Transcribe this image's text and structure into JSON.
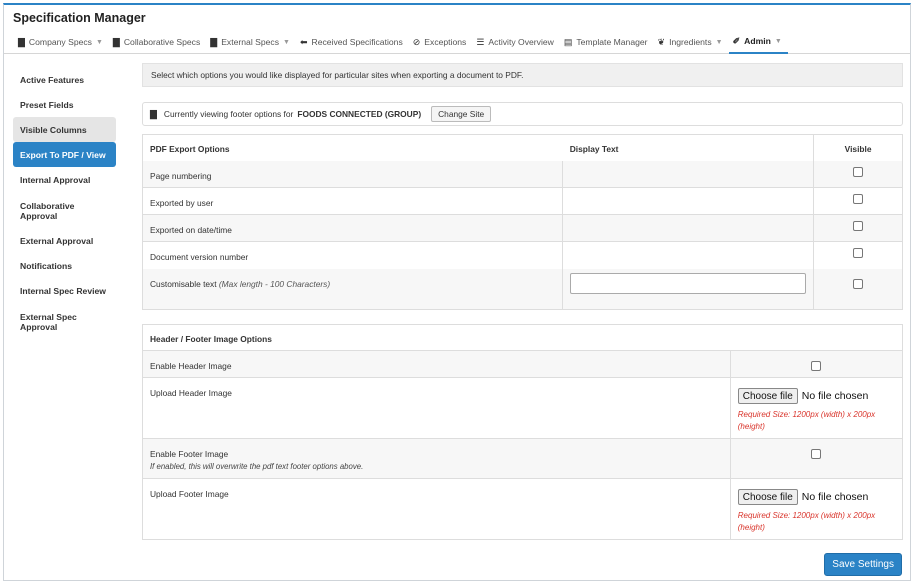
{
  "app": {
    "title": "Specification Manager"
  },
  "nav": [
    {
      "label": "Company Specs",
      "icon": "building-icon",
      "glyph": "▇",
      "caret": true
    },
    {
      "label": "Collaborative Specs",
      "icon": "building-icon",
      "glyph": "▇",
      "caret": false
    },
    {
      "label": "External Specs",
      "icon": "building-icon",
      "glyph": "▇",
      "caret": true
    },
    {
      "label": "Received Specifications",
      "icon": "arrow-left-icon",
      "glyph": "⬅",
      "caret": false
    },
    {
      "label": "Exceptions",
      "icon": "check-circle-icon",
      "glyph": "⊘",
      "caret": false
    },
    {
      "label": "Activity Overview",
      "icon": "server-icon",
      "glyph": "☰",
      "caret": false
    },
    {
      "label": "Template Manager",
      "icon": "template-icon",
      "glyph": "▤",
      "caret": false
    },
    {
      "label": "Ingredients",
      "icon": "leaf-icon",
      "glyph": "❦",
      "caret": true
    },
    {
      "label": "Admin",
      "icon": "wrench-icon",
      "glyph": "✐",
      "caret": true,
      "active": true
    }
  ],
  "sidebar": [
    {
      "label": "Active Features",
      "state": "normal"
    },
    {
      "label": "Preset Fields",
      "state": "normal"
    },
    {
      "label": "Visible Columns",
      "state": "grey"
    },
    {
      "label": "Export To PDF / View",
      "state": "active"
    },
    {
      "label": "Internal Approval",
      "state": "normal"
    },
    {
      "label": "Collaborative Approval",
      "state": "normal"
    },
    {
      "label": "External Approval",
      "state": "normal"
    },
    {
      "label": "Notifications",
      "state": "normal"
    },
    {
      "label": "Internal Spec Review",
      "state": "normal"
    },
    {
      "label": "External Spec Approval",
      "state": "normal"
    }
  ],
  "intro_text": "Select which options you would like displayed for particular sites when exporting a document to PDF.",
  "site": {
    "prefix": "Currently viewing footer options for",
    "name": "FOODS CONNECTED (GROUP)",
    "change_label": "Change Site"
  },
  "pdf_table": {
    "headers": {
      "option": "PDF Export Options",
      "display": "Display Text",
      "visible": "Visible"
    },
    "rows": [
      {
        "label": "Page numbering",
        "checked": false
      },
      {
        "label": "Exported by user",
        "checked": false
      },
      {
        "label": "Exported on date/time",
        "checked": false
      },
      {
        "label": "Document version number",
        "checked": false
      }
    ],
    "custom": {
      "label": "Customisable text",
      "hint": "(Max length - 100 Characters)",
      "value": "",
      "checked": false
    }
  },
  "image_table": {
    "header": "Header / Footer Image Options",
    "enable_header": "Enable Header Image",
    "upload_header": "Upload Header Image",
    "enable_footer": "Enable Footer Image",
    "footer_hint": "If enabled, this will overwrite the pdf text footer options above.",
    "upload_footer": "Upload Footer Image",
    "choose_file": "Choose file",
    "no_file": "No file chosen",
    "required_size": "Required Size: 1200px (width) x 200px (height)"
  },
  "save_label": "Save Settings"
}
